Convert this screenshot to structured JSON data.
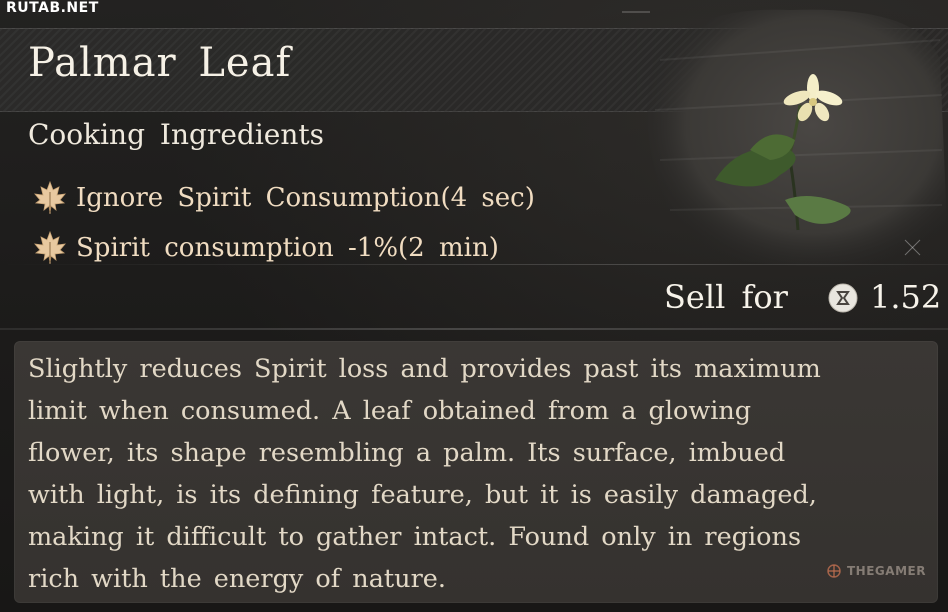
{
  "watermark": "RUTAB.NET",
  "item": {
    "name": "Palmar Leaf",
    "category": "Cooking Ingredients",
    "effects": [
      {
        "icon": "maple-leaf-icon",
        "text": "Ignore Spirit Consumption(4 sec)"
      },
      {
        "icon": "maple-leaf-icon",
        "text": "Spirit consumption -1%(2 min)"
      }
    ],
    "image": "palmar-leaf-flower"
  },
  "sell": {
    "label": "Sell for",
    "icon": "currency-coin-icon",
    "price": "1.52"
  },
  "description": [
    "Slightly reduces Spirit loss and provides past its maximum",
    "limit when consumed. A leaf obtained from a glowing",
    "flower, its shape resembling a palm. Its surface, imbued",
    "with light, is its defining feature, but it is easily damaged,",
    "making it difficult to gather intact. Found only in regions",
    "rich with the energy of nature."
  ],
  "brand": "THEGAMER",
  "colors": {
    "effect_text": "#f0dcc1",
    "icon": "#e8c9a0",
    "panel": "#3a3734"
  }
}
